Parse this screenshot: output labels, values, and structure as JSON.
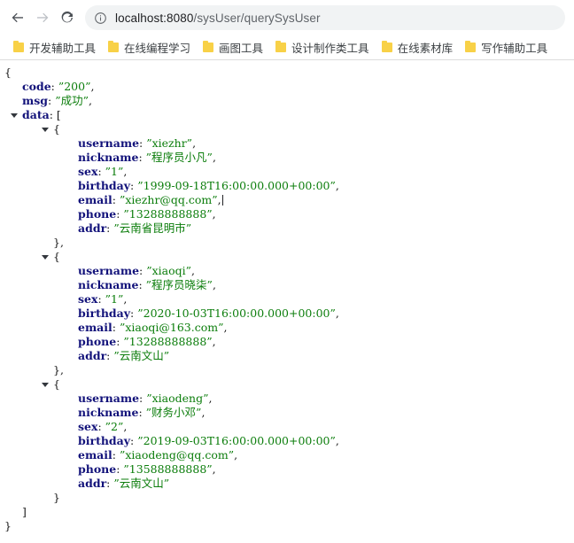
{
  "browser": {
    "nav": {
      "back_label": "Back",
      "forward_label": "Forward",
      "reload_label": "Reload"
    },
    "omnibox": {
      "security_icon": "info-circle-icon",
      "url_host": "localhost:8080",
      "url_path": "/sysUser/querySysUser",
      "url_full": "localhost:8080/sysUser/querySysUser"
    },
    "bookmarks": [
      {
        "label": "开发辅助工具",
        "icon": "folder-icon"
      },
      {
        "label": "在线编程学习",
        "icon": "folder-icon"
      },
      {
        "label": "画图工具",
        "icon": "folder-icon"
      },
      {
        "label": "设计制作类工具",
        "icon": "folder-icon"
      },
      {
        "label": "在线素材库",
        "icon": "folder-icon"
      },
      {
        "label": "写作辅助工具",
        "icon": "folder-icon"
      }
    ]
  },
  "colors": {
    "key": "#12127a",
    "string": "#0b7d0b",
    "punctuation": "#1a1a1a",
    "folder": "#f8d147",
    "omnibox_bg": "#f1f3f4"
  },
  "json_response": {
    "code": "200",
    "msg": "成功",
    "data": [
      {
        "username": "xiezhr",
        "nickname": "程序员小凡",
        "sex": "1",
        "birthday": "1999-09-18T16:00:00.000+00:00",
        "email": "xiezhr@qq.com",
        "phone": "13288888888",
        "addr": "云南省昆明市"
      },
      {
        "username": "xiaoqi",
        "nickname": "程序员晓柒",
        "sex": "1",
        "birthday": "2020-10-03T16:00:00.000+00:00",
        "email": "xiaoqi@163.com",
        "phone": "13288888888",
        "addr": "云南文山"
      },
      {
        "username": "xiaodeng",
        "nickname": "财务小邓",
        "sex": "2",
        "birthday": "2019-09-03T16:00:00.000+00:00",
        "email": "xiaodeng@qq.com",
        "phone": "13588888888",
        "addr": "云南文山"
      }
    ]
  },
  "viewer": {
    "brace_open": "{",
    "brace_close": "}",
    "bracket_open": "[",
    "bracket_close": "]",
    "comma": ",",
    "colon": ": ",
    "quote": "”",
    "quote_open": "”",
    "keys": {
      "code": "code",
      "msg": "msg",
      "data": "data",
      "username": "username",
      "nickname": "nickname",
      "sex": "sex",
      "birthday": "birthday",
      "email": "email",
      "phone": "phone",
      "addr": "addr"
    },
    "caret_after_line": "email-record-0"
  }
}
